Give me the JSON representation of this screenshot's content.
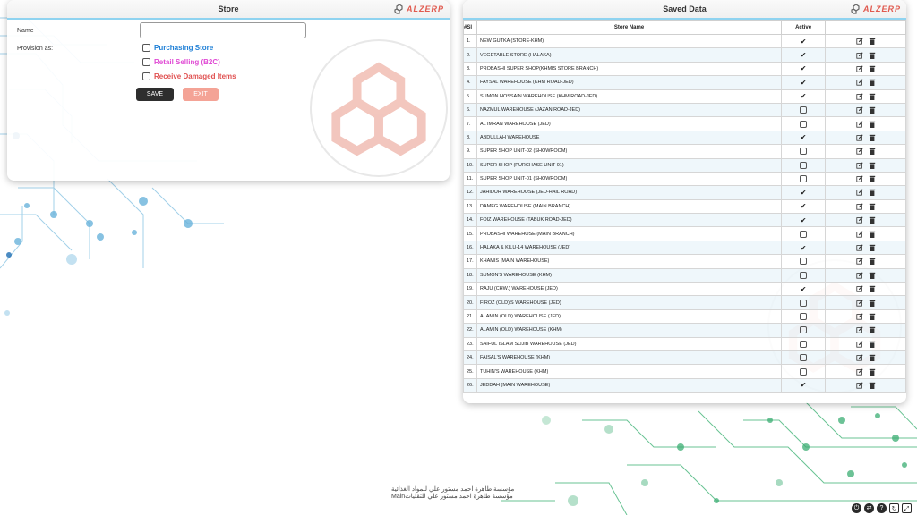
{
  "store_form": {
    "title": "Store",
    "brand": "ALZERP",
    "name_label": "Name",
    "name_value": "",
    "provision_label": "Provision as:",
    "options": [
      {
        "label": "Purchasing Store",
        "color": "#1e7fd6",
        "checked": false
      },
      {
        "label": "Retail Selling (B2C)",
        "color": "#e04ad4",
        "checked": false
      },
      {
        "label": "Receive Damaged Items",
        "color": "#e05050",
        "checked": false
      }
    ],
    "save_label": "SAVE",
    "exit_label": "EXIT"
  },
  "saved_data": {
    "title": "Saved Data",
    "brand": "ALZERP",
    "columns": [
      "#Sl",
      "Store Name",
      "Active"
    ],
    "rows": [
      {
        "sl": "1.",
        "name": "NEW GUTKA (STORE-KHM)",
        "active": true
      },
      {
        "sl": "2.",
        "name": "VEGETABLE STORE (HALAKA)",
        "active": true
      },
      {
        "sl": "3.",
        "name": "PROBASHI SUPER SHOP(KHMIS STORE BRANCH)",
        "active": true
      },
      {
        "sl": "4.",
        "name": "FAYSAL WAREHOUSE (KHM ROAD-JED)",
        "active": true
      },
      {
        "sl": "5.",
        "name": "SUMON HOSSAIN WAREHOUSE (KHM ROAD-JED)",
        "active": true
      },
      {
        "sl": "6.",
        "name": "NAZMUL WAREHOUSE (JAZAN ROAD-JED)",
        "active": false
      },
      {
        "sl": "7.",
        "name": "AL IMRAN WAREHOUSE (JED)",
        "active": false
      },
      {
        "sl": "8.",
        "name": "ABDULLAH WAREHOUSE",
        "active": true
      },
      {
        "sl": "9.",
        "name": "SUPER SHOP UNIT-02 (SHOWROOM)",
        "active": false
      },
      {
        "sl": "10.",
        "name": "SUPER SHOP (PURCHASE UNIT-01)",
        "active": false
      },
      {
        "sl": "11.",
        "name": "SUPER SHOP UNIT-01 (SHOWROOM)",
        "active": false
      },
      {
        "sl": "12.",
        "name": "JAHIDUR WAREHOUSE (JED-HAIL ROAD)",
        "active": true
      },
      {
        "sl": "13.",
        "name": "DAMEG WAREHOUSE (MAIN BRANCH)",
        "active": true
      },
      {
        "sl": "14.",
        "name": "FOIZ WAREHOUSE (TABUK ROAD-JED)",
        "active": true
      },
      {
        "sl": "15.",
        "name": "PROBASHI WAREHOSE (MAIN BRANCH)",
        "active": false
      },
      {
        "sl": "16.",
        "name": "HALAKA & KILU-14 WAREHOUSE (JED)",
        "active": true
      },
      {
        "sl": "17.",
        "name": "KHAMIS (MAIN WAREHOUSE)",
        "active": false
      },
      {
        "sl": "18.",
        "name": "SUMON'S WAREHOUSE (KHM)",
        "active": false
      },
      {
        "sl": "19.",
        "name": "RAJU (CHW.) WAREHOUSE (JED)",
        "active": true
      },
      {
        "sl": "20.",
        "name": "FIROZ (OLD)'S WAREHOUSE (JED)",
        "active": false
      },
      {
        "sl": "21.",
        "name": "ALAMIN (OLD) WAREHOUSE (JED)",
        "active": false
      },
      {
        "sl": "22.",
        "name": "ALAMIN (OLD) WAREHOUSE (KHM)",
        "active": false
      },
      {
        "sl": "23.",
        "name": "SAIFUL ISLAM SOJIB WAREHOUSE (JED)",
        "active": false
      },
      {
        "sl": "24.",
        "name": "FAISAL'S WAREHOUSE (KHM)",
        "active": false
      },
      {
        "sl": "25.",
        "name": "TUHIN'S WAREHOUSE (KHM)",
        "active": false
      },
      {
        "sl": "26.",
        "name": "JEDDAH (MAIN WAREHOUSE)",
        "active": true
      }
    ]
  },
  "footer": {
    "line1": "مؤسسة طاهرة احمد مستور علي للمواد الغذائية",
    "line2": "مؤسسة طاهرة احمد مستور علي للتقليات",
    "line2_suffix": "Main"
  },
  "colors": {
    "accent": "#8fd3f0",
    "brand": "#e05a4f",
    "circuit_blue": "#5aa9d6",
    "circuit_green": "#3cae73"
  }
}
